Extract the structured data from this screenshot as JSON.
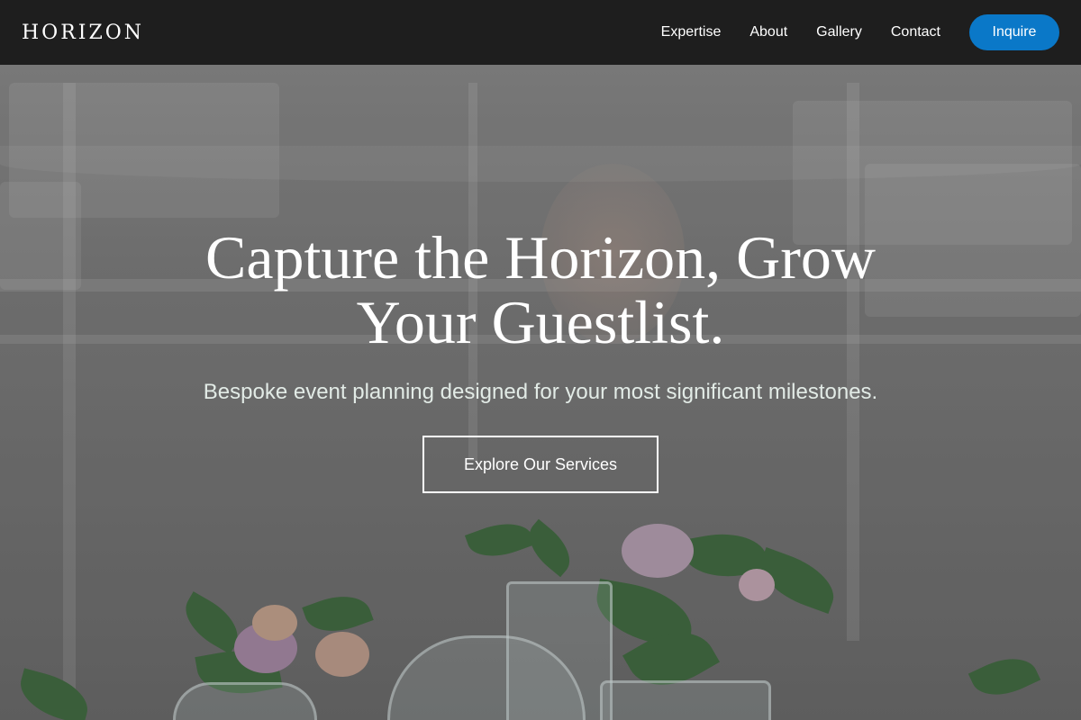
{
  "navbar": {
    "brand": "HORIZON",
    "links": [
      "Expertise",
      "About",
      "Gallery",
      "Contact"
    ],
    "cta_label": "Inquire"
  },
  "hero": {
    "title": "Capture the Horizon, Grow Your Guestlist.",
    "subtitle": "Bespoke event planning designed for your most significant milestones.",
    "button_label": "Explore Our Services"
  },
  "colors": {
    "navbar_bg": "#1e1e1e",
    "cta_accent": "#0a78c8",
    "subtitle_text": "#e2ebe6"
  }
}
